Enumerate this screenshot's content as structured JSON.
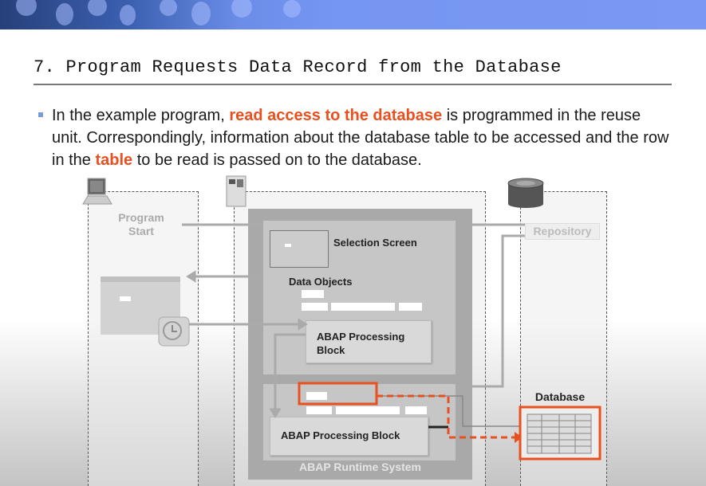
{
  "slide": {
    "title": "7. Program Requests Data Record from the Database",
    "bullet": {
      "before": "In the example program, ",
      "hl1": "read access to the database",
      "mid": " is programmed in the reuse unit. Correspondingly, information about the database table to be accessed and the row in the ",
      "hl2": "table",
      "after": " to be read is passed on to the database."
    }
  },
  "diagram": {
    "program_start": "Program Start",
    "repository": "Repository",
    "selection_screen": "Selection Screen",
    "data_objects": "Data Objects",
    "abap_block_upper": "ABAP Processing Block",
    "abap_block_lower": "ABAP Processing Block",
    "runtime": "ABAP Runtime System",
    "database_table": "Database Table"
  },
  "colors": {
    "accent": "#e8501f",
    "banner": "#7596f2"
  }
}
